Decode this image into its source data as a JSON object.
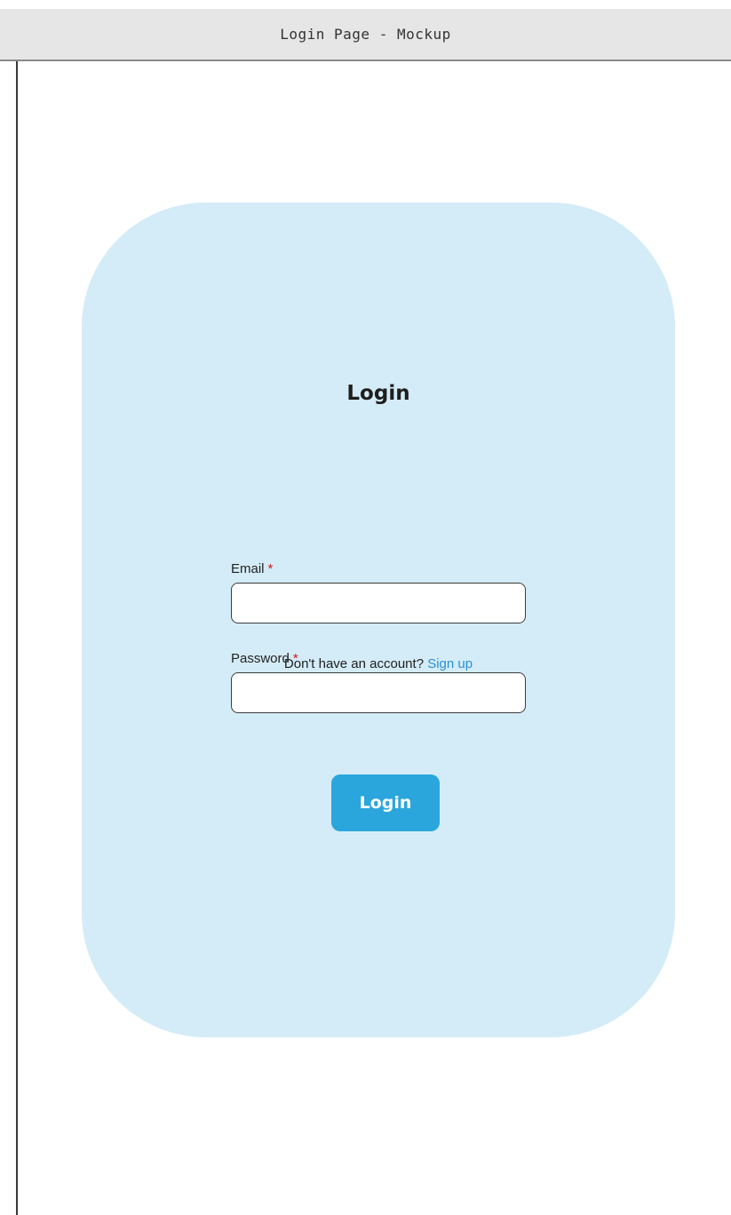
{
  "window": {
    "title": "Login Page - Mockup"
  },
  "login_form": {
    "heading": "Login",
    "email": {
      "label": "Email",
      "required_marker": "*",
      "value": "",
      "placeholder": ""
    },
    "password": {
      "label": "Password",
      "required_marker": "*",
      "value": "",
      "placeholder": ""
    },
    "submit_label": "Login",
    "signup_prompt": "Don't have an account?",
    "signup_link": "Sign up"
  },
  "colors": {
    "card_background": "#d4ecf7",
    "button_background": "#2aa6dc",
    "link": "#2a8fd6",
    "required_marker": "#d21a1a"
  }
}
